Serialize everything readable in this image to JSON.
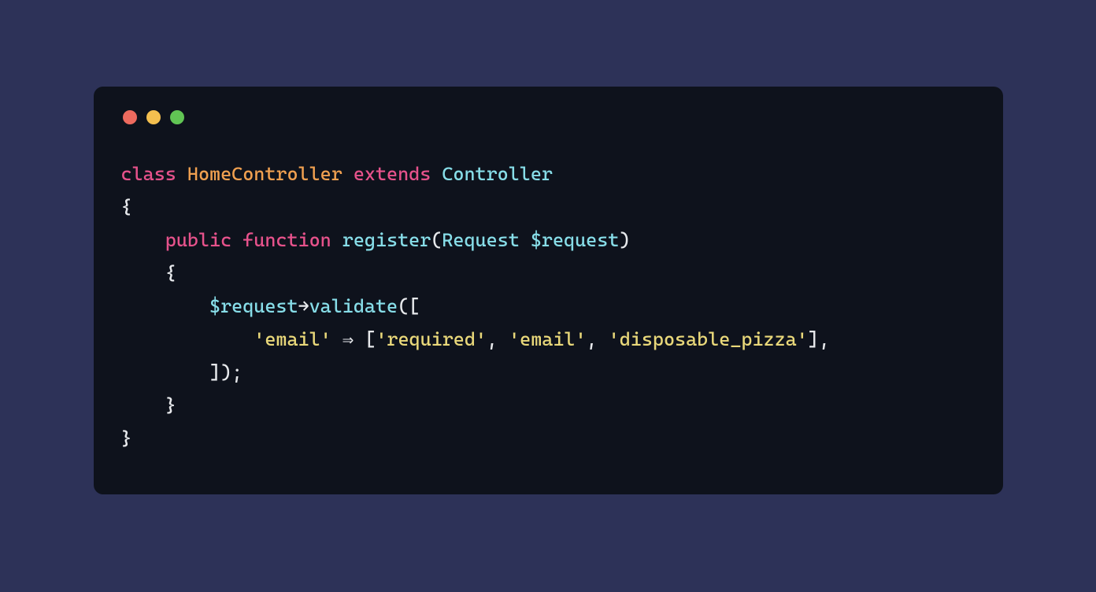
{
  "colors": {
    "background": "#2d3258",
    "window": "#0e121c",
    "trafficRed": "#ed6a5e",
    "trafficYellow": "#f4bf4f",
    "trafficGreen": "#61c554"
  },
  "code": {
    "line1": {
      "kw_class": "class",
      "classname": "HomeController",
      "kw_extends": "extends",
      "basename": "Controller"
    },
    "line2": {
      "brace": "{"
    },
    "line3": {
      "indent": "    ",
      "kw_public": "public",
      "kw_function": "function",
      "funcname": "register",
      "lparen": "(",
      "paramtype": "Request",
      "paramvar": "$request",
      "rparen": ")"
    },
    "line4": {
      "indent": "    ",
      "brace": "{"
    },
    "line5": {
      "indent": "        ",
      "var": "$request",
      "arrow": "→",
      "method": "validate",
      "lparen": "(",
      "lbracket": "["
    },
    "line6": {
      "indent": "            ",
      "key": "'email'",
      "fat_arrow": " ⇒ ",
      "lbracket": "[",
      "val1": "'required'",
      "comma1": ", ",
      "val2": "'email'",
      "comma2": ", ",
      "val3": "'disposable_pizza'",
      "rbracket": "]",
      "trailing_comma": ","
    },
    "line7": {
      "indent": "        ",
      "rbracket": "]",
      "rparen": ")",
      "semi": ";"
    },
    "line8": {
      "indent": "    ",
      "brace": "}"
    },
    "line9": {
      "brace": "}"
    }
  }
}
